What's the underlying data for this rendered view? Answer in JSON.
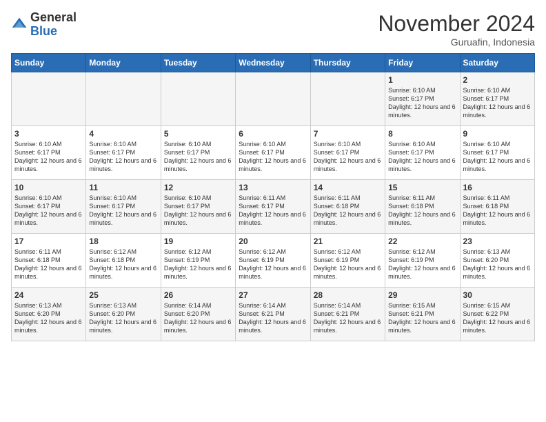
{
  "logo": {
    "general": "General",
    "blue": "Blue"
  },
  "header": {
    "month": "November 2024",
    "location": "Guruafin, Indonesia"
  },
  "weekdays": [
    "Sunday",
    "Monday",
    "Tuesday",
    "Wednesday",
    "Thursday",
    "Friday",
    "Saturday"
  ],
  "weeks": [
    [
      {
        "day": "",
        "info": ""
      },
      {
        "day": "",
        "info": ""
      },
      {
        "day": "",
        "info": ""
      },
      {
        "day": "",
        "info": ""
      },
      {
        "day": "",
        "info": ""
      },
      {
        "day": "1",
        "info": "Sunrise: 6:10 AM\nSunset: 6:17 PM\nDaylight: 12 hours and 6 minutes."
      },
      {
        "day": "2",
        "info": "Sunrise: 6:10 AM\nSunset: 6:17 PM\nDaylight: 12 hours and 6 minutes."
      }
    ],
    [
      {
        "day": "3",
        "info": "Sunrise: 6:10 AM\nSunset: 6:17 PM\nDaylight: 12 hours and 6 minutes."
      },
      {
        "day": "4",
        "info": "Sunrise: 6:10 AM\nSunset: 6:17 PM\nDaylight: 12 hours and 6 minutes."
      },
      {
        "day": "5",
        "info": "Sunrise: 6:10 AM\nSunset: 6:17 PM\nDaylight: 12 hours and 6 minutes."
      },
      {
        "day": "6",
        "info": "Sunrise: 6:10 AM\nSunset: 6:17 PM\nDaylight: 12 hours and 6 minutes."
      },
      {
        "day": "7",
        "info": "Sunrise: 6:10 AM\nSunset: 6:17 PM\nDaylight: 12 hours and 6 minutes."
      },
      {
        "day": "8",
        "info": "Sunrise: 6:10 AM\nSunset: 6:17 PM\nDaylight: 12 hours and 6 minutes."
      },
      {
        "day": "9",
        "info": "Sunrise: 6:10 AM\nSunset: 6:17 PM\nDaylight: 12 hours and 6 minutes."
      }
    ],
    [
      {
        "day": "10",
        "info": "Sunrise: 6:10 AM\nSunset: 6:17 PM\nDaylight: 12 hours and 6 minutes."
      },
      {
        "day": "11",
        "info": "Sunrise: 6:10 AM\nSunset: 6:17 PM\nDaylight: 12 hours and 6 minutes."
      },
      {
        "day": "12",
        "info": "Sunrise: 6:10 AM\nSunset: 6:17 PM\nDaylight: 12 hours and 6 minutes."
      },
      {
        "day": "13",
        "info": "Sunrise: 6:11 AM\nSunset: 6:17 PM\nDaylight: 12 hours and 6 minutes."
      },
      {
        "day": "14",
        "info": "Sunrise: 6:11 AM\nSunset: 6:18 PM\nDaylight: 12 hours and 6 minutes."
      },
      {
        "day": "15",
        "info": "Sunrise: 6:11 AM\nSunset: 6:18 PM\nDaylight: 12 hours and 6 minutes."
      },
      {
        "day": "16",
        "info": "Sunrise: 6:11 AM\nSunset: 6:18 PM\nDaylight: 12 hours and 6 minutes."
      }
    ],
    [
      {
        "day": "17",
        "info": "Sunrise: 6:11 AM\nSunset: 6:18 PM\nDaylight: 12 hours and 6 minutes."
      },
      {
        "day": "18",
        "info": "Sunrise: 6:12 AM\nSunset: 6:18 PM\nDaylight: 12 hours and 6 minutes."
      },
      {
        "day": "19",
        "info": "Sunrise: 6:12 AM\nSunset: 6:19 PM\nDaylight: 12 hours and 6 minutes."
      },
      {
        "day": "20",
        "info": "Sunrise: 6:12 AM\nSunset: 6:19 PM\nDaylight: 12 hours and 6 minutes."
      },
      {
        "day": "21",
        "info": "Sunrise: 6:12 AM\nSunset: 6:19 PM\nDaylight: 12 hours and 6 minutes."
      },
      {
        "day": "22",
        "info": "Sunrise: 6:12 AM\nSunset: 6:19 PM\nDaylight: 12 hours and 6 minutes."
      },
      {
        "day": "23",
        "info": "Sunrise: 6:13 AM\nSunset: 6:20 PM\nDaylight: 12 hours and 6 minutes."
      }
    ],
    [
      {
        "day": "24",
        "info": "Sunrise: 6:13 AM\nSunset: 6:20 PM\nDaylight: 12 hours and 6 minutes."
      },
      {
        "day": "25",
        "info": "Sunrise: 6:13 AM\nSunset: 6:20 PM\nDaylight: 12 hours and 6 minutes."
      },
      {
        "day": "26",
        "info": "Sunrise: 6:14 AM\nSunset: 6:20 PM\nDaylight: 12 hours and 6 minutes."
      },
      {
        "day": "27",
        "info": "Sunrise: 6:14 AM\nSunset: 6:21 PM\nDaylight: 12 hours and 6 minutes."
      },
      {
        "day": "28",
        "info": "Sunrise: 6:14 AM\nSunset: 6:21 PM\nDaylight: 12 hours and 6 minutes."
      },
      {
        "day": "29",
        "info": "Sunrise: 6:15 AM\nSunset: 6:21 PM\nDaylight: 12 hours and 6 minutes."
      },
      {
        "day": "30",
        "info": "Sunrise: 6:15 AM\nSunset: 6:22 PM\nDaylight: 12 hours and 6 minutes."
      }
    ]
  ]
}
